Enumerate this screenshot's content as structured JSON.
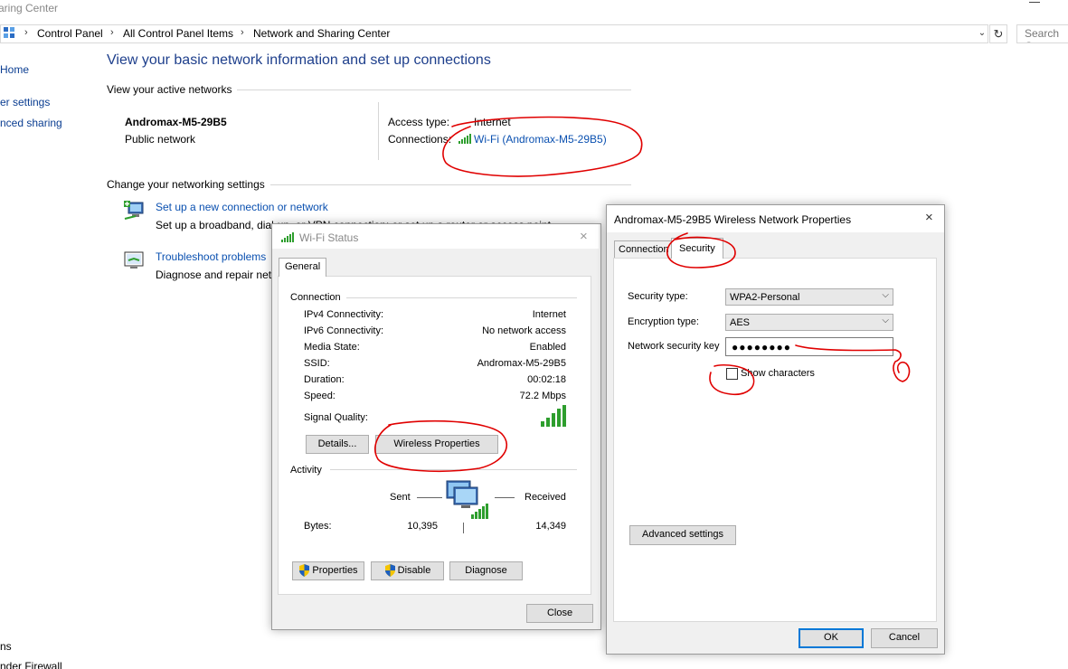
{
  "window": {
    "title_fragment": "aring Center"
  },
  "address_bar": {
    "crumbs": [
      "Control Panel",
      "All Control Panel Items",
      "Network and Sharing Center"
    ],
    "dropdown_glyph": "⌄",
    "refresh_glyph": "↻",
    "search_placeholder": "Search Co"
  },
  "left_nav": {
    "home": "Home",
    "adapter": "er settings",
    "sharing": "nced sharing",
    "bottom1": "ns",
    "bottom2": "nder Firewall"
  },
  "main": {
    "heading": "View your basic network information and set up connections",
    "active_networks_label": "View your active networks",
    "network_name": "Andromax-M5-29B5",
    "network_type": "Public network",
    "access_type_label": "Access type:",
    "access_type_value": "Internet",
    "connections_label": "Connections:",
    "connections_value": "Wi-Fi (Andromax-M5-29B5)",
    "change_label": "Change your networking settings",
    "setup_link": "Set up a new connection or network",
    "setup_desc": "Set up a broadband, dial-up, or VPN connection; or set up a router or access point.",
    "troubleshoot_link": "Troubleshoot problems",
    "troubleshoot_desc": "Diagnose and repair network problems, or get troubleshooting information."
  },
  "wifi_status": {
    "title": "Wi-Fi Status",
    "close_glyph": "×",
    "tab": "General",
    "connection_section": "Connection",
    "rows": [
      {
        "label": "IPv4 Connectivity:",
        "value": "Internet"
      },
      {
        "label": "IPv6 Connectivity:",
        "value": "No network access"
      },
      {
        "label": "Media State:",
        "value": "Enabled"
      },
      {
        "label": "SSID:",
        "value": "Andromax-M5-29B5"
      },
      {
        "label": "Duration:",
        "value": "00:02:18"
      },
      {
        "label": "Speed:",
        "value": "72.2 Mbps"
      }
    ],
    "signal_quality_label": "Signal Quality:",
    "details_button": "Details...",
    "wireless_props_button": "Wireless Properties",
    "activity_section": "Activity",
    "sent_label": "Sent",
    "received_label": "Received",
    "bytes_label": "Bytes:",
    "bytes_sent": "10,395",
    "bytes_received": "14,349",
    "properties_button": "Properties",
    "disable_button": "Disable",
    "diagnose_button": "Diagnose",
    "close_button": "Close"
  },
  "wireless_props": {
    "title": "Andromax-M5-29B5 Wireless Network Properties",
    "close_glyph": "×",
    "tab_connection": "Connection",
    "tab_security": "Security",
    "security_type_label": "Security type:",
    "security_type_value": "WPA2-Personal",
    "encryption_type_label": "Encryption type:",
    "encryption_type_value": "AES",
    "key_label": "Network security key",
    "key_value": "●●●●●●●●",
    "show_chars_label": "Show characters",
    "advanced_button": "Advanced settings",
    "ok_button": "OK",
    "cancel_button": "Cancel",
    "dropdown_glyph": "⌵"
  },
  "colors": {
    "link": "#0a50b0",
    "heading": "#1e3f8c",
    "annotation": "#e00000",
    "signal": "#2e9e2e"
  }
}
